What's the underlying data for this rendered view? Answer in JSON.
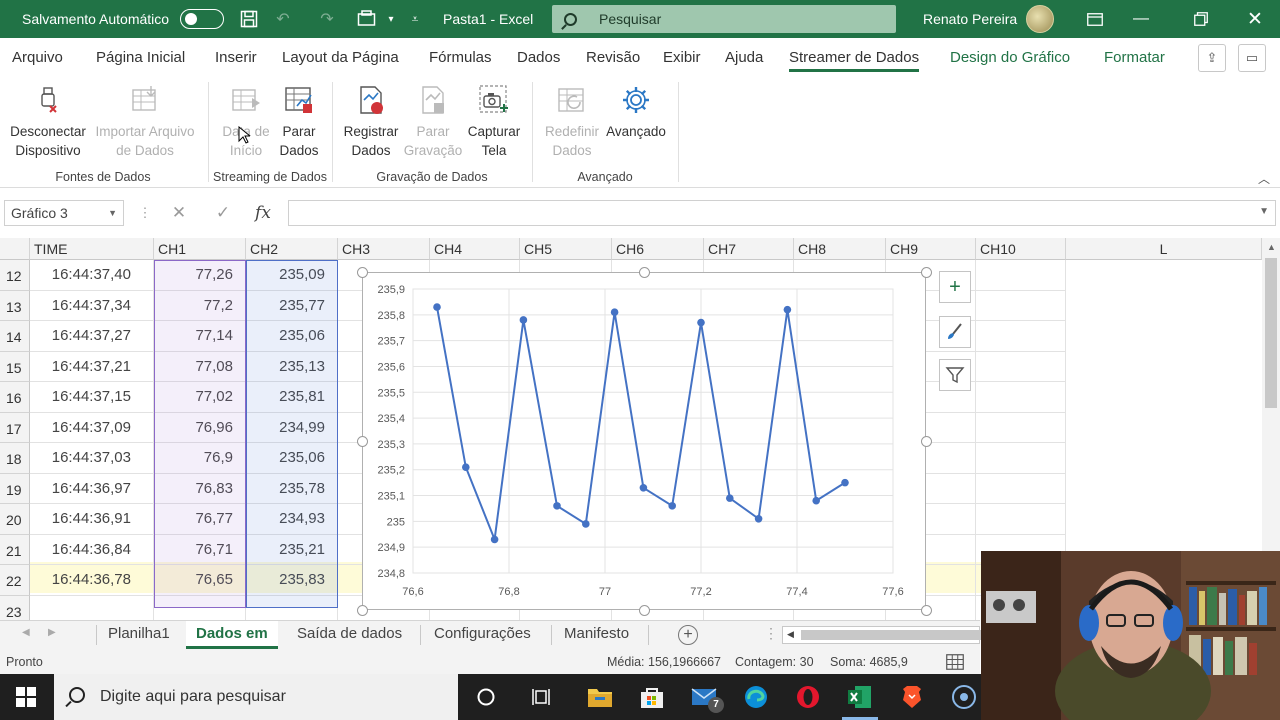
{
  "titlebar": {
    "autosave_label": "Salvamento Automático",
    "doc_title": "Pasta1  -  Excel",
    "search_placeholder": "Pesquisar",
    "user_name": "Renato Pereira"
  },
  "tabs": [
    "Arquivo",
    "Página Inicial",
    "Inserir",
    "Layout da Página",
    "Fórmulas",
    "Dados",
    "Revisão",
    "Exibir",
    "Ajuda",
    "Streamer de Dados",
    "Design do Gráfico",
    "Formatar"
  ],
  "active_tab": "Streamer de Dados",
  "ribbon": {
    "buttons": [
      {
        "line1": "Desconectar",
        "line2": "Dispositivo",
        "enabled": true,
        "icon": "usb-disconnect-icon"
      },
      {
        "line1": "Importar Arquivo",
        "line2": "de Dados",
        "enabled": false,
        "icon": "import-icon"
      },
      {
        "line1": "Data de",
        "line2": "Início",
        "enabled": false,
        "icon": "start-data-icon"
      },
      {
        "line1": "Parar",
        "line2": "Dados",
        "enabled": true,
        "icon": "stop-data-icon"
      },
      {
        "line1": "Registrar",
        "line2": "Dados",
        "enabled": true,
        "icon": "record-icon"
      },
      {
        "line1": "Parar",
        "line2": "Gravação",
        "enabled": false,
        "icon": "stop-record-icon"
      },
      {
        "line1": "Capturar",
        "line2": "Tela",
        "enabled": true,
        "icon": "camera-icon"
      },
      {
        "line1": "Redefinir",
        "line2": "Dados",
        "enabled": false,
        "icon": "reset-icon"
      },
      {
        "line1": "Avançado",
        "line2": "",
        "enabled": true,
        "icon": "gear-icon"
      }
    ],
    "groups": [
      "Fontes de Dados",
      "Streaming de Dados",
      "Gravação de Dados",
      "Avançado"
    ]
  },
  "formula_bar": {
    "name_box": "Gráfico 3",
    "formula": ""
  },
  "columns": [
    "TIME",
    "CH1",
    "CH2",
    "CH3",
    "CH4",
    "CH5",
    "CH6",
    "CH7",
    "CH8",
    "CH9",
    "CH10",
    "L"
  ],
  "rows": [
    {
      "n": "12",
      "time": "16:44:37,40",
      "ch1": "77,26",
      "ch2": "235,09"
    },
    {
      "n": "13",
      "time": "16:44:37,34",
      "ch1": "77,2",
      "ch2": "235,77"
    },
    {
      "n": "14",
      "time": "16:44:37,27",
      "ch1": "77,14",
      "ch2": "235,06"
    },
    {
      "n": "15",
      "time": "16:44:37,21",
      "ch1": "77,08",
      "ch2": "235,13"
    },
    {
      "n": "16",
      "time": "16:44:37,15",
      "ch1": "77,02",
      "ch2": "235,81"
    },
    {
      "n": "17",
      "time": "16:44:37,09",
      "ch1": "76,96",
      "ch2": "234,99"
    },
    {
      "n": "18",
      "time": "16:44:37,03",
      "ch1": "76,9",
      "ch2": "235,06"
    },
    {
      "n": "19",
      "time": "16:44:36,97",
      "ch1": "76,83",
      "ch2": "235,78"
    },
    {
      "n": "20",
      "time": "16:44:36,91",
      "ch1": "76,77",
      "ch2": "234,93"
    },
    {
      "n": "21",
      "time": "16:44:36,84",
      "ch1": "76,71",
      "ch2": "235,21"
    },
    {
      "n": "22",
      "time": "16:44:36,78",
      "ch1": "76,65",
      "ch2": "235,83"
    },
    {
      "n": "23",
      "time": "",
      "ch1": "",
      "ch2": ""
    }
  ],
  "chart_data": {
    "type": "scatter",
    "x": [
      76.65,
      76.71,
      76.77,
      76.83,
      76.9,
      76.96,
      77.02,
      77.08,
      77.14,
      77.2,
      77.26,
      77.32,
      77.38,
      77.44,
      77.5
    ],
    "y": [
      235.83,
      235.21,
      234.93,
      235.78,
      235.06,
      234.99,
      235.81,
      235.13,
      235.06,
      235.77,
      235.09,
      235.01,
      235.82,
      235.08,
      235.15
    ],
    "xlim": [
      76.6,
      77.6
    ],
    "ylim": [
      234.8,
      235.9
    ],
    "x_ticks": [
      "76,6",
      "76,8",
      "77",
      "77,2",
      "77,4",
      "77,6"
    ],
    "y_ticks": [
      "234,8",
      "234,9",
      "235",
      "235,1",
      "235,2",
      "235,3",
      "235,4",
      "235,5",
      "235,6",
      "235,7",
      "235,8",
      "235,9"
    ],
    "series_color": "#4472c4",
    "grid": true
  },
  "sheet_tabs": [
    "Planilha1",
    "Dados em",
    "Saída de dados",
    "Configurações",
    "Manifesto"
  ],
  "active_sheet": "Dados em",
  "statusbar": {
    "mode": "Pronto",
    "average": "Média: 156,1966667",
    "count": "Contagem: 30",
    "sum": "Soma: 4685,9"
  },
  "taskbar": {
    "search_placeholder": "Digite aqui para pesquisar",
    "mail_badge": "7"
  },
  "colors": {
    "excel_green": "#217346",
    "accent_blue": "#4472c4"
  }
}
